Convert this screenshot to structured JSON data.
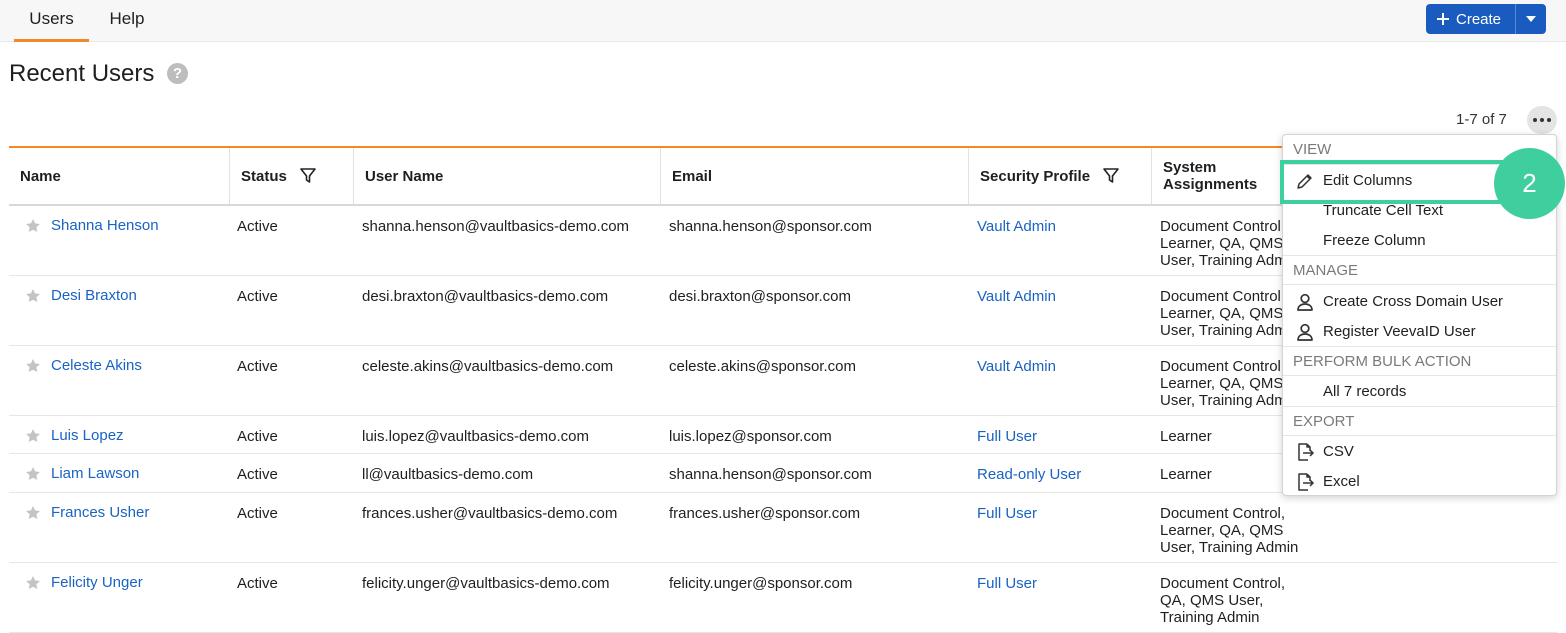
{
  "tabs": [
    {
      "label": "Users"
    },
    {
      "label": "Help"
    }
  ],
  "create_button": {
    "label": "Create"
  },
  "page_title": "Recent Users",
  "paging": "1-7 of 7",
  "columns": [
    "Name",
    "Status",
    "User Name",
    "Email",
    "Security Profile",
    "System Assignments"
  ],
  "rows": [
    {
      "name": "Shanna Henson",
      "status": "Active",
      "username": "shanna.henson@vaultbasics-demo.com",
      "email": "shanna.henson@sponsor.com",
      "profile": "Vault Admin",
      "assign": [
        "Document Control,",
        "Learner, QA, QMS",
        "User, Training Admin"
      ]
    },
    {
      "name": "Desi Braxton",
      "status": "Active",
      "username": "desi.braxton@vaultbasics-demo.com",
      "email": "desi.braxton@sponsor.com",
      "profile": "Vault Admin",
      "assign": [
        "Document Control,",
        "Learner, QA, QMS",
        "User, Training Admin"
      ]
    },
    {
      "name": "Celeste Akins",
      "status": "Active",
      "username": "celeste.akins@vaultbasics-demo.com",
      "email": "celeste.akins@sponsor.com",
      "profile": "Vault Admin",
      "assign": [
        "Document Control,",
        "Learner, QA, QMS",
        "User, Training Admin"
      ]
    },
    {
      "name": "Luis Lopez",
      "status": "Active",
      "username": "luis.lopez@vaultbasics-demo.com",
      "email": "luis.lopez@sponsor.com",
      "profile": "Full User",
      "assign": [
        "Learner"
      ]
    },
    {
      "name": "Liam Lawson",
      "status": "Active",
      "username": "ll@vaultbasics-demo.com",
      "email": "shanna.henson@sponsor.com",
      "profile": "Read-only User",
      "assign": [
        "Learner"
      ]
    },
    {
      "name": "Frances Usher",
      "status": "Active",
      "username": "frances.usher@vaultbasics-demo.com",
      "email": "frances.usher@sponsor.com",
      "profile": "Full User",
      "assign": [
        "Document Control,",
        "Learner, QA, QMS",
        "User, Training Admin"
      ]
    },
    {
      "name": "Felicity Unger",
      "status": "Active",
      "username": "felicity.unger@vaultbasics-demo.com",
      "email": "felicity.unger@sponsor.com",
      "profile": "Full User",
      "assign": [
        "Document Control,",
        "QA, QMS User,",
        "Training Admin"
      ]
    }
  ],
  "menu": {
    "view_header": "VIEW",
    "edit_columns": "Edit Columns",
    "truncate": "Truncate Cell Text",
    "freeze": "Freeze Column",
    "manage_header": "MANAGE",
    "cross_domain": "Create Cross Domain User",
    "register_veeva": "Register VeevaID User",
    "bulk_header": "PERFORM BULK ACTION",
    "all_records": "All 7 records",
    "export_header": "EXPORT",
    "csv": "CSV",
    "excel": "Excel"
  },
  "step_badge": "2",
  "colors": {
    "accent_orange": "#f08a24",
    "link_blue": "#1a63c2",
    "button_blue": "#1a5bbf",
    "highlight_green": "#3dcf9f"
  }
}
